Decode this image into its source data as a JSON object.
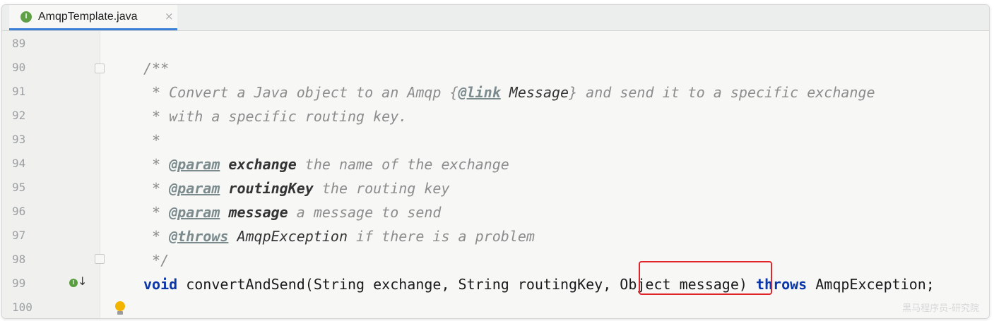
{
  "tab": {
    "icon_text": "I",
    "label": "AmqpTemplate.java",
    "close": "×"
  },
  "lines": [
    {
      "num": "89"
    },
    {
      "num": "90",
      "text": "/**"
    },
    {
      "num": "91",
      "pre": " * Convert a Java object to an Amqp {",
      "tag": "@link",
      "msg": " Message",
      "post": "} and send it to a specific exchange"
    },
    {
      "num": "92",
      "text": " * with a specific routing key."
    },
    {
      "num": "93",
      "text": " *"
    },
    {
      "num": "94",
      "pre": " * ",
      "tag": "@param",
      "bold": " exchange",
      "post": " the name of the exchange"
    },
    {
      "num": "95",
      "pre": " * ",
      "tag": "@param",
      "bold": " routingKey",
      "post": " the routing key"
    },
    {
      "num": "96",
      "pre": " * ",
      "tag": "@param",
      "bold": " message",
      "post": " a message to send"
    },
    {
      "num": "97",
      "pre": " * ",
      "tag": "@throws",
      "msg": " AmqpException",
      "post": " if there is a problem"
    },
    {
      "num": "98",
      "text": " */"
    },
    {
      "num": "99",
      "kw1": "void",
      "mid": " convertAndSend(String exchange, String routingKey, Object message) ",
      "kw2": "throws",
      "end": " AmqpException;"
    },
    {
      "num": "100"
    }
  ],
  "gutter_icons": {
    "implement": "implemented-icon",
    "bulb": "lightbulb-icon"
  },
  "highlight_target": "Object message",
  "watermark": "黑马程序员-研究院"
}
